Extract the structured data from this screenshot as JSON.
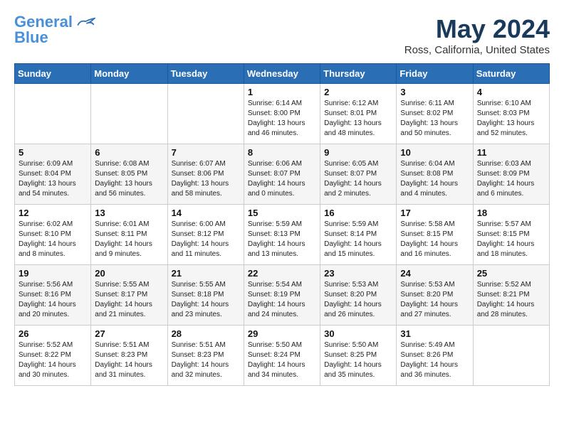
{
  "header": {
    "logo_line1": "General",
    "logo_line2": "Blue",
    "month_year": "May 2024",
    "location": "Ross, California, United States"
  },
  "days_of_week": [
    "Sunday",
    "Monday",
    "Tuesday",
    "Wednesday",
    "Thursday",
    "Friday",
    "Saturday"
  ],
  "weeks": [
    [
      {
        "day": "",
        "info": ""
      },
      {
        "day": "",
        "info": ""
      },
      {
        "day": "",
        "info": ""
      },
      {
        "day": "1",
        "info": "Sunrise: 6:14 AM\nSunset: 8:00 PM\nDaylight: 13 hours\nand 46 minutes."
      },
      {
        "day": "2",
        "info": "Sunrise: 6:12 AM\nSunset: 8:01 PM\nDaylight: 13 hours\nand 48 minutes."
      },
      {
        "day": "3",
        "info": "Sunrise: 6:11 AM\nSunset: 8:02 PM\nDaylight: 13 hours\nand 50 minutes."
      },
      {
        "day": "4",
        "info": "Sunrise: 6:10 AM\nSunset: 8:03 PM\nDaylight: 13 hours\nand 52 minutes."
      }
    ],
    [
      {
        "day": "5",
        "info": "Sunrise: 6:09 AM\nSunset: 8:04 PM\nDaylight: 13 hours\nand 54 minutes."
      },
      {
        "day": "6",
        "info": "Sunrise: 6:08 AM\nSunset: 8:05 PM\nDaylight: 13 hours\nand 56 minutes."
      },
      {
        "day": "7",
        "info": "Sunrise: 6:07 AM\nSunset: 8:06 PM\nDaylight: 13 hours\nand 58 minutes."
      },
      {
        "day": "8",
        "info": "Sunrise: 6:06 AM\nSunset: 8:07 PM\nDaylight: 14 hours\nand 0 minutes."
      },
      {
        "day": "9",
        "info": "Sunrise: 6:05 AM\nSunset: 8:07 PM\nDaylight: 14 hours\nand 2 minutes."
      },
      {
        "day": "10",
        "info": "Sunrise: 6:04 AM\nSunset: 8:08 PM\nDaylight: 14 hours\nand 4 minutes."
      },
      {
        "day": "11",
        "info": "Sunrise: 6:03 AM\nSunset: 8:09 PM\nDaylight: 14 hours\nand 6 minutes."
      }
    ],
    [
      {
        "day": "12",
        "info": "Sunrise: 6:02 AM\nSunset: 8:10 PM\nDaylight: 14 hours\nand 8 minutes."
      },
      {
        "day": "13",
        "info": "Sunrise: 6:01 AM\nSunset: 8:11 PM\nDaylight: 14 hours\nand 9 minutes."
      },
      {
        "day": "14",
        "info": "Sunrise: 6:00 AM\nSunset: 8:12 PM\nDaylight: 14 hours\nand 11 minutes."
      },
      {
        "day": "15",
        "info": "Sunrise: 5:59 AM\nSunset: 8:13 PM\nDaylight: 14 hours\nand 13 minutes."
      },
      {
        "day": "16",
        "info": "Sunrise: 5:59 AM\nSunset: 8:14 PM\nDaylight: 14 hours\nand 15 minutes."
      },
      {
        "day": "17",
        "info": "Sunrise: 5:58 AM\nSunset: 8:15 PM\nDaylight: 14 hours\nand 16 minutes."
      },
      {
        "day": "18",
        "info": "Sunrise: 5:57 AM\nSunset: 8:15 PM\nDaylight: 14 hours\nand 18 minutes."
      }
    ],
    [
      {
        "day": "19",
        "info": "Sunrise: 5:56 AM\nSunset: 8:16 PM\nDaylight: 14 hours\nand 20 minutes."
      },
      {
        "day": "20",
        "info": "Sunrise: 5:55 AM\nSunset: 8:17 PM\nDaylight: 14 hours\nand 21 minutes."
      },
      {
        "day": "21",
        "info": "Sunrise: 5:55 AM\nSunset: 8:18 PM\nDaylight: 14 hours\nand 23 minutes."
      },
      {
        "day": "22",
        "info": "Sunrise: 5:54 AM\nSunset: 8:19 PM\nDaylight: 14 hours\nand 24 minutes."
      },
      {
        "day": "23",
        "info": "Sunrise: 5:53 AM\nSunset: 8:20 PM\nDaylight: 14 hours\nand 26 minutes."
      },
      {
        "day": "24",
        "info": "Sunrise: 5:53 AM\nSunset: 8:20 PM\nDaylight: 14 hours\nand 27 minutes."
      },
      {
        "day": "25",
        "info": "Sunrise: 5:52 AM\nSunset: 8:21 PM\nDaylight: 14 hours\nand 28 minutes."
      }
    ],
    [
      {
        "day": "26",
        "info": "Sunrise: 5:52 AM\nSunset: 8:22 PM\nDaylight: 14 hours\nand 30 minutes."
      },
      {
        "day": "27",
        "info": "Sunrise: 5:51 AM\nSunset: 8:23 PM\nDaylight: 14 hours\nand 31 minutes."
      },
      {
        "day": "28",
        "info": "Sunrise: 5:51 AM\nSunset: 8:23 PM\nDaylight: 14 hours\nand 32 minutes."
      },
      {
        "day": "29",
        "info": "Sunrise: 5:50 AM\nSunset: 8:24 PM\nDaylight: 14 hours\nand 34 minutes."
      },
      {
        "day": "30",
        "info": "Sunrise: 5:50 AM\nSunset: 8:25 PM\nDaylight: 14 hours\nand 35 minutes."
      },
      {
        "day": "31",
        "info": "Sunrise: 5:49 AM\nSunset: 8:26 PM\nDaylight: 14 hours\nand 36 minutes."
      },
      {
        "day": "",
        "info": ""
      }
    ]
  ]
}
